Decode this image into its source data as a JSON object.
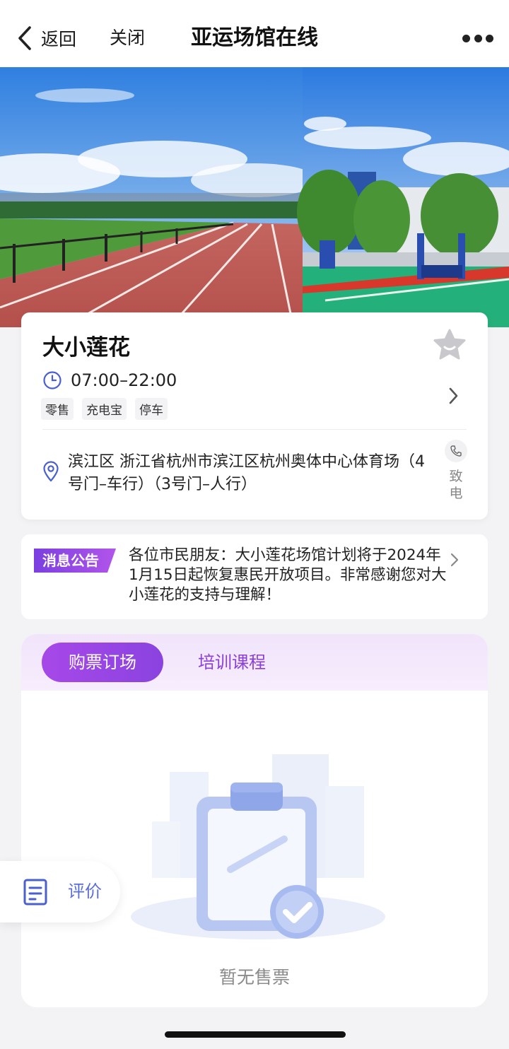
{
  "nav": {
    "back_label": "返回",
    "close_label": "关闭",
    "title": "亚运场馆在线"
  },
  "venue": {
    "name": "大小莲花",
    "hours": "07:00–22:00",
    "tags": [
      "零售",
      "充电宝",
      "停车"
    ],
    "address": "滨江区 浙江省杭州市滨江区杭州奥体中心体育场（4号门–车行）（3号门–人行）",
    "call_label": "致电"
  },
  "notice": {
    "badge": "消息公告",
    "text": "各位市民朋友：大小莲花场馆计划将于2024年1月15日起恢复惠民开放项目。非常感谢您对大小莲花的支持与理解！"
  },
  "booking": {
    "tabs": [
      {
        "label": "购票订场",
        "active": true
      },
      {
        "label": "培训课程",
        "active": false
      }
    ],
    "empty_text": "暂无售票"
  },
  "review": {
    "label": "评价"
  },
  "colors": {
    "accent_purple": "#9a45e5",
    "tab_text_purple": "#8a3fd6",
    "review_blue": "#5b6ed8",
    "icon_blue": "#4a5fd0"
  }
}
